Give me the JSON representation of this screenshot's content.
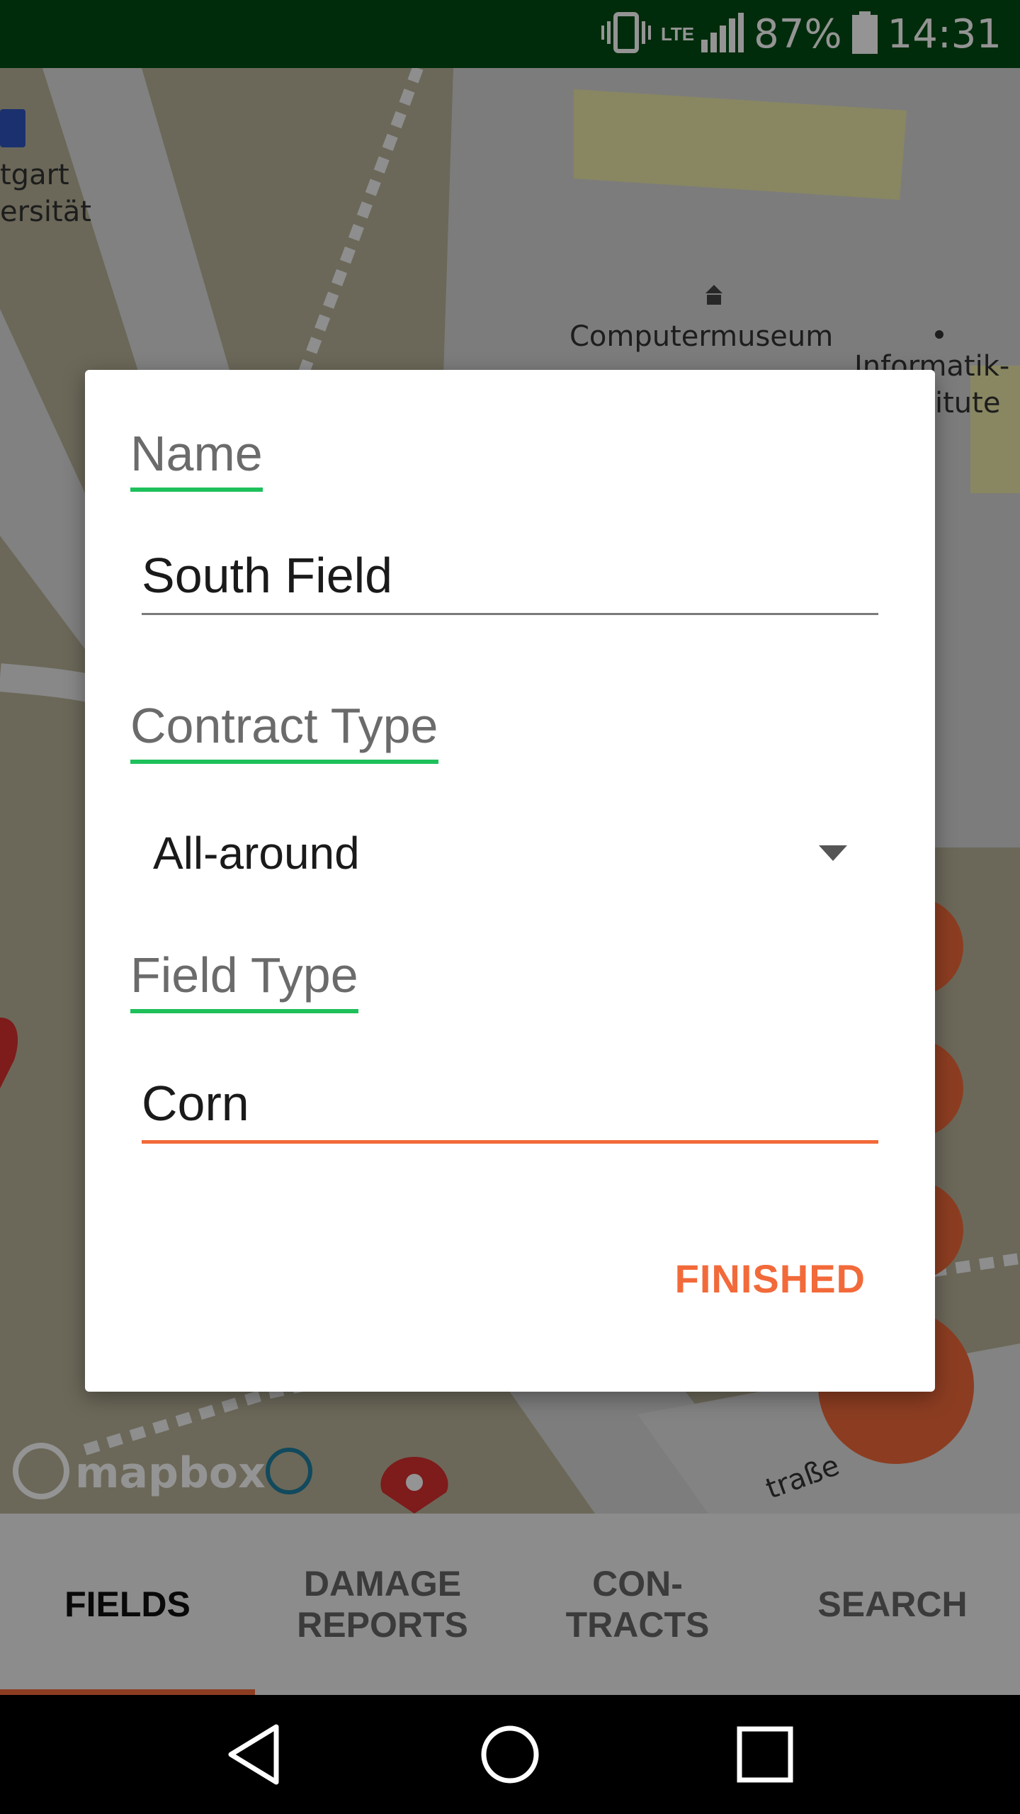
{
  "status_bar": {
    "network": "LTE",
    "battery": "87%",
    "time": "14:31"
  },
  "map": {
    "labels": [
      "tgart",
      "ersität",
      "Computermuseum",
      "Informatik-",
      "itute",
      "traße"
    ],
    "attribution": "mapbox"
  },
  "dialog": {
    "name_label": "Name",
    "name_value": "South Field",
    "contract_type_label": "Contract Type",
    "contract_type_value": "All-around",
    "field_type_label": "Field Type",
    "field_type_value": "Corn",
    "finished_button": "FINISHED"
  },
  "tabs": [
    {
      "label": "FIELDS",
      "active": true
    },
    {
      "label": "DAMAGE REPORTS",
      "line1": "DAMAGE",
      "line2": "REPORTS"
    },
    {
      "label": "CON-TRACTS",
      "line1": "CON-",
      "line2": "TRACTS"
    },
    {
      "label": "SEARCH"
    }
  ],
  "colors": {
    "accent": "#f26a3a",
    "label_underline": "#1ec05a",
    "status_bar": "#004d13"
  }
}
